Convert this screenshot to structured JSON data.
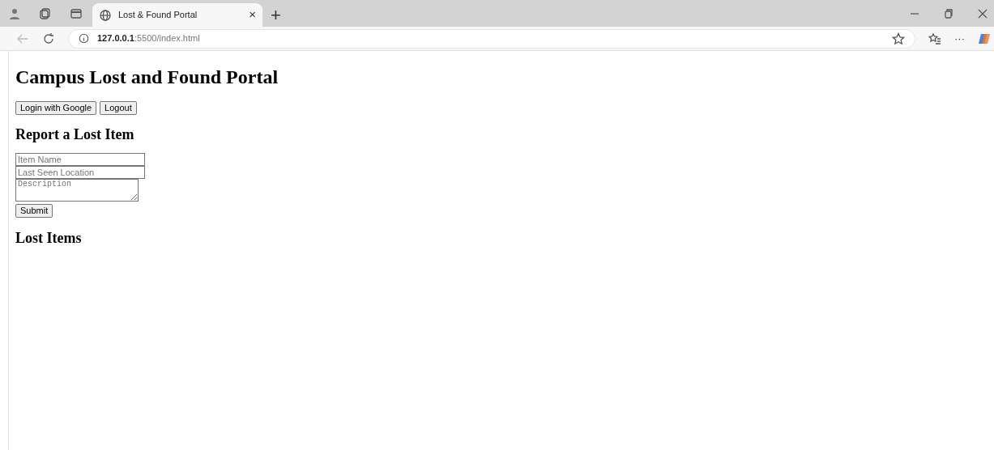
{
  "browser": {
    "tab_title": "Lost & Found Portal",
    "close_tab": "×",
    "new_tab": "+",
    "url_host": "127.0.0.1",
    "url_path": ":5500/index.html",
    "more": "···"
  },
  "page": {
    "title": "Campus Lost and Found Portal",
    "auth_buttons": [
      "Login with Google",
      "Logout"
    ],
    "report_heading": "Report a Lost Item",
    "fields": [
      {
        "kind": "input",
        "placeholder": "Item Name"
      },
      {
        "kind": "input",
        "placeholder": "Last Seen Location"
      },
      {
        "kind": "textarea",
        "placeholder": "Description"
      }
    ],
    "submit": "Submit",
    "list_heading": "Lost Items"
  }
}
